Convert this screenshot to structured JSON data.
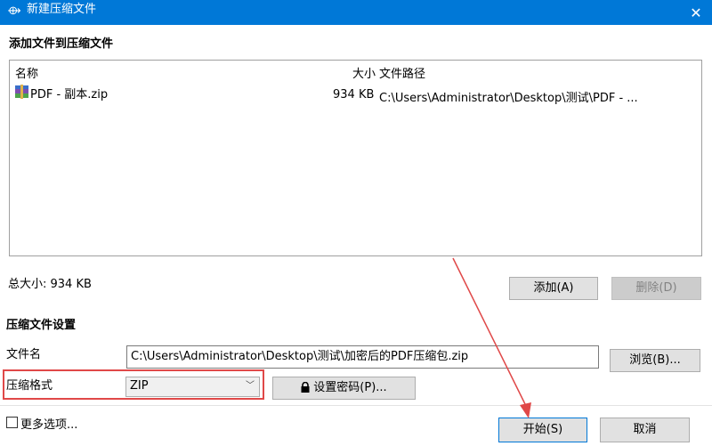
{
  "window": {
    "title": "新建压缩文件",
    "app_icon_glyph": "⟴",
    "close_glyph": "✕"
  },
  "add_section": {
    "header": "添加文件到压缩文件"
  },
  "file_list": {
    "columns": {
      "name": "名称",
      "size": "大小",
      "path": "文件路径"
    },
    "rows": [
      {
        "name": "PDF - 副本.zip",
        "size": "934 KB",
        "path": "C:\\Users\\Administrator\\Desktop\\测试\\PDF - ...",
        "icon": "zip-archive-icon"
      }
    ]
  },
  "total_size": "总大小: 934 KB",
  "buttons": {
    "add": "添加(A)",
    "delete": "删除(D)",
    "browse": "浏览(B)...",
    "set_password": "设置密码(P)...",
    "start": "开始(S)",
    "cancel": "取消"
  },
  "settings_section": {
    "header": "压缩文件设置",
    "filename_label": "文件名",
    "filename_value": "C:\\Users\\Administrator\\Desktop\\测试\\加密后的PDF压缩包.zip",
    "format_label": "压缩格式",
    "format_value": "ZIP",
    "more_options_label": "更多选项..."
  },
  "colors": {
    "titlebar": "#0078d7",
    "highlight": "#e04848",
    "arrow": "#e04848"
  }
}
